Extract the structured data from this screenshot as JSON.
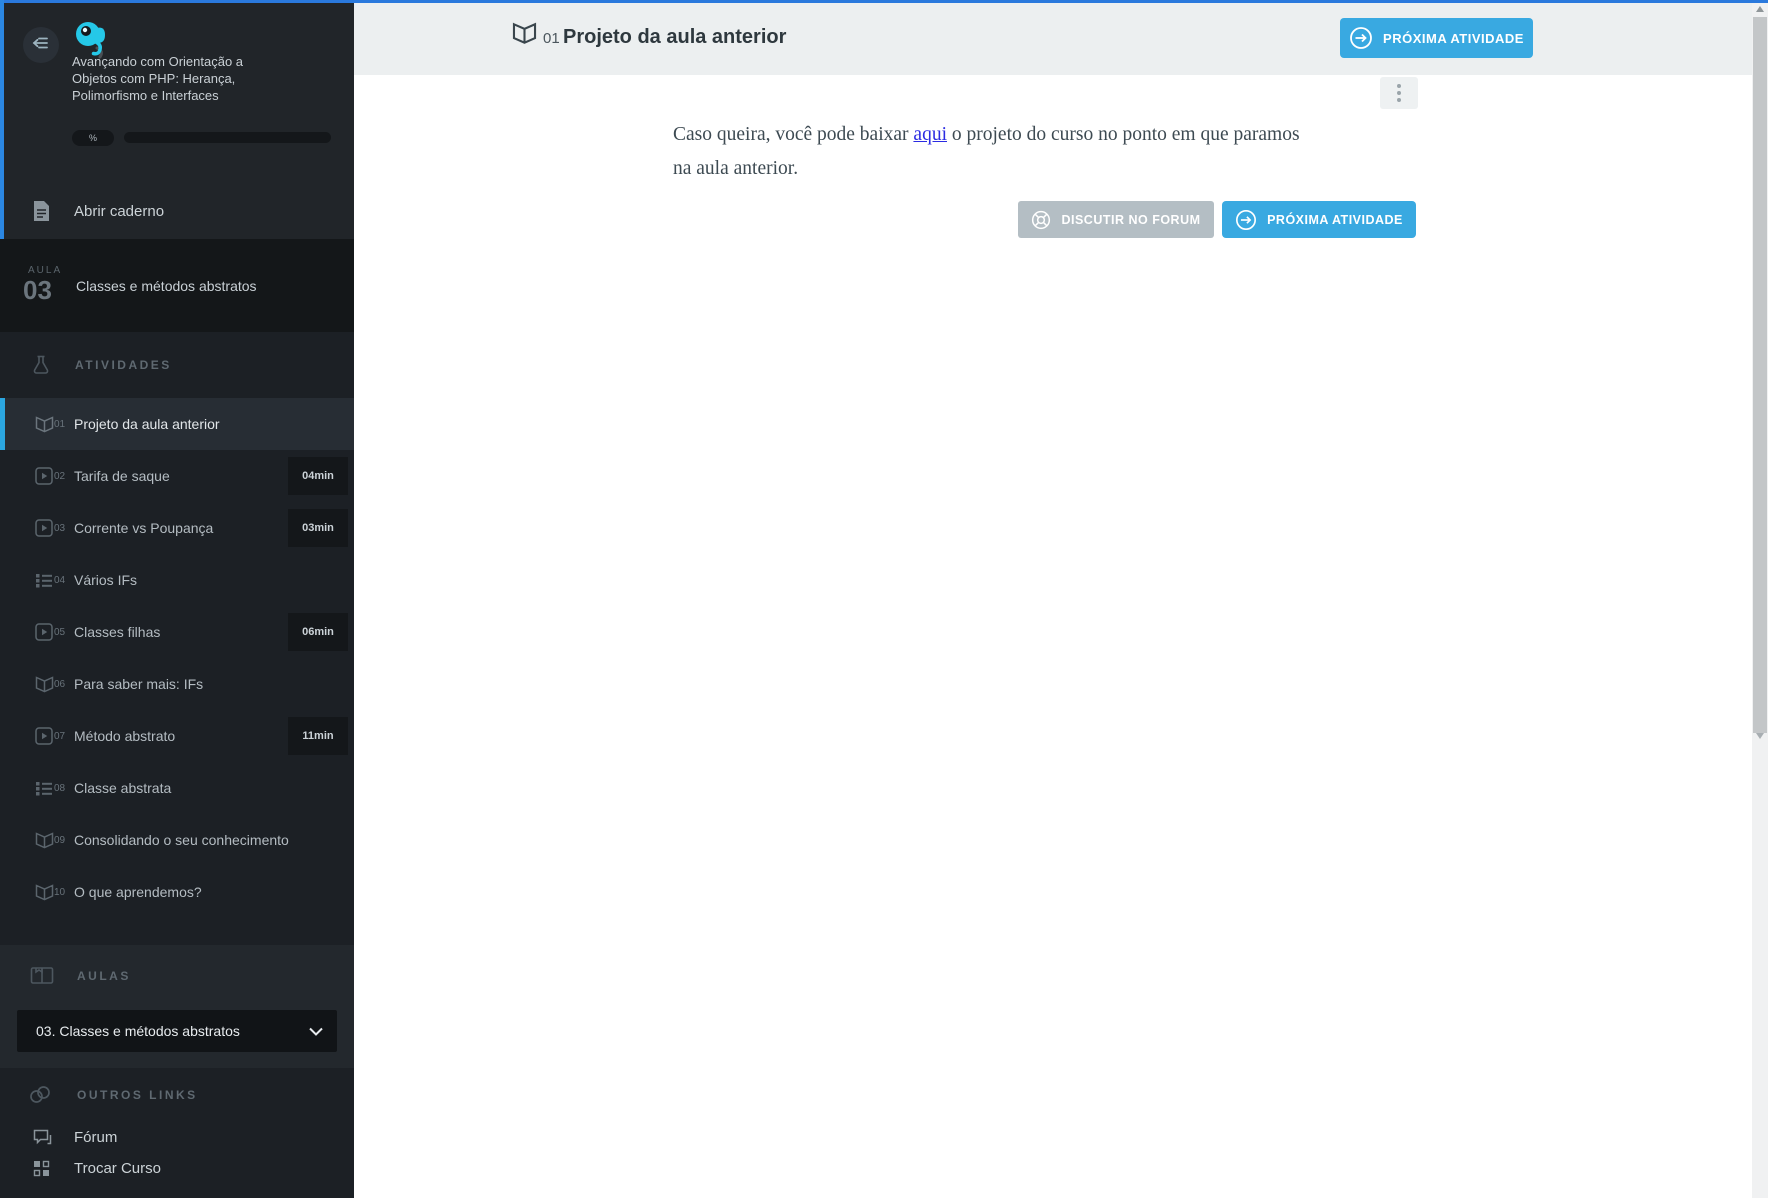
{
  "accent": {
    "top_line_color": "#2a79dd",
    "left_line_color": "#2b87e2",
    "button_blue": "#39a9e1",
    "link_blue": "#2b2be2",
    "active_item_border": "#2ba6e0"
  },
  "sidebar": {
    "course_title_lines": [
      "Avançando com Orientação a",
      "Objetos com PHP: Herança,",
      "Polimorfismo e Interfaces"
    ],
    "progress_badge": "%",
    "open_notebook_label": "Abrir caderno",
    "lesson": {
      "kicker": "AULA",
      "number": "03",
      "title": "Classes e métodos abstratos"
    },
    "sections": {
      "activities": "ATIVIDADES",
      "lessons": "AULAS",
      "other_links": "OUTROS LINKS"
    },
    "activities": [
      {
        "num": "01",
        "label": "Projeto da aula anterior",
        "icon": "book-icon",
        "duration": "",
        "active": true
      },
      {
        "num": "02",
        "label": "Tarifa de saque",
        "icon": "video-icon",
        "duration": "04min",
        "active": false
      },
      {
        "num": "03",
        "label": "Corrente vs Poupança",
        "icon": "video-icon",
        "duration": "03min",
        "active": false
      },
      {
        "num": "04",
        "label": "Vários IFs",
        "icon": "list-icon",
        "duration": "",
        "active": false
      },
      {
        "num": "05",
        "label": "Classes filhas",
        "icon": "video-icon",
        "duration": "06min",
        "active": false
      },
      {
        "num": "06",
        "label": "Para saber mais: IFs",
        "icon": "book-icon",
        "duration": "",
        "active": false
      },
      {
        "num": "07",
        "label": "Método abstrato",
        "icon": "video-icon",
        "duration": "11min",
        "active": false
      },
      {
        "num": "08",
        "label": "Classe abstrata",
        "icon": "list-icon",
        "duration": "",
        "active": false
      },
      {
        "num": "09",
        "label": "Consolidando o seu conhecimento",
        "icon": "book-icon",
        "duration": "",
        "active": false
      },
      {
        "num": "10",
        "label": "O que aprendemos?",
        "icon": "book-icon",
        "duration": "",
        "active": false
      }
    ],
    "lessons_dropdown_value": "03. Classes e métodos abstratos",
    "links": [
      {
        "label": "Fórum",
        "icon": "forum-chat-icon"
      },
      {
        "label": "Trocar Curso",
        "icon": "switch-course-icon"
      }
    ]
  },
  "main": {
    "header": {
      "activity_number": "01",
      "title": "Projeto da aula anterior",
      "next_button_label": "PRÓXIMA ATIVIDADE"
    },
    "body": {
      "text_before_link": "Caso queira, você pode baixar ",
      "link_text": "aqui",
      "text_after_link": " o projeto do curso no ponto em que paramos na aula anterior.",
      "forum_button_label": "DISCUTIR NO FORUM",
      "next_button_label": "PRÓXIMA ATIVIDADE"
    }
  }
}
